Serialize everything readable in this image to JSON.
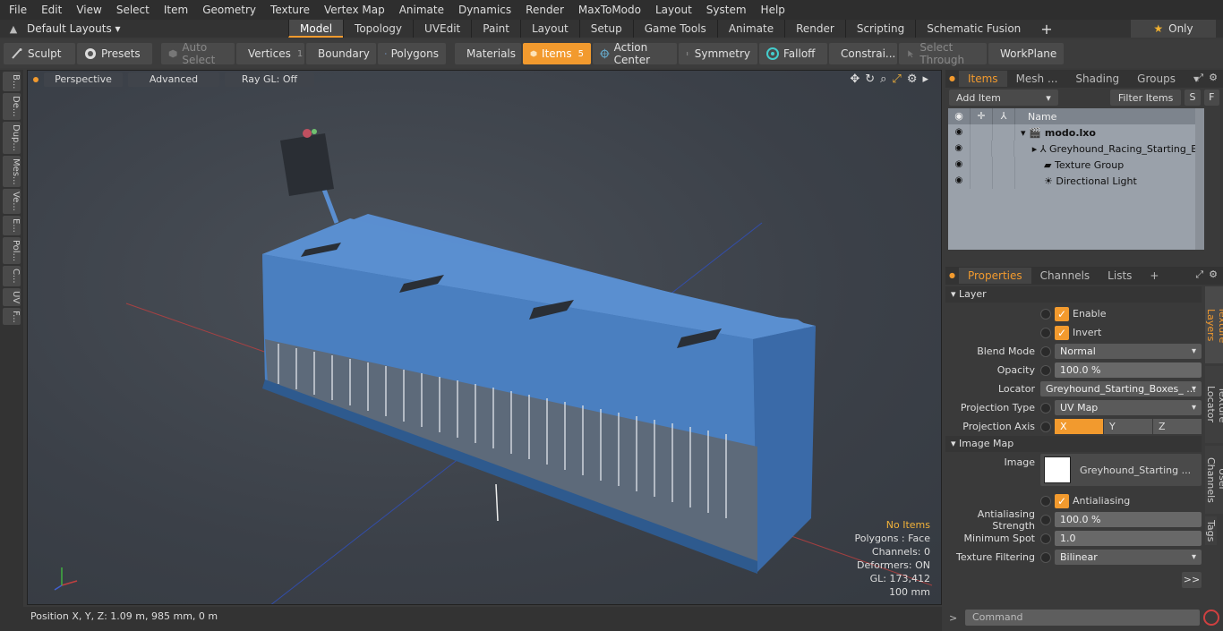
{
  "menu": [
    "File",
    "Edit",
    "View",
    "Select",
    "Item",
    "Geometry",
    "Texture",
    "Vertex Map",
    "Animate",
    "Dynamics",
    "Render",
    "MaxToModo",
    "Layout",
    "System",
    "Help"
  ],
  "layout": {
    "selector": "Default Layouts ▾",
    "tabs": [
      "Model",
      "Topology",
      "UVEdit",
      "Paint",
      "Layout",
      "Setup",
      "Game Tools",
      "Animate",
      "Render",
      "Scripting",
      "Schematic Fusion"
    ],
    "active_tab": "Model",
    "only_label": "Only"
  },
  "toolbar": {
    "sculpt": "Sculpt",
    "presets": "Presets",
    "auto_select": "Auto Select",
    "vertices": "Vertices",
    "vertices_count": "1",
    "boundary": "Boundary",
    "polygons": "Polygons",
    "materials": "Materials",
    "items": "Items",
    "items_count": "5",
    "action_center": "Action Center",
    "symmetry": "Symmetry",
    "falloff": "Falloff",
    "constraints": "Constrai...",
    "select_through": "Select Through",
    "workplane": "WorkPlane"
  },
  "left_tabs": [
    "B...",
    "De...",
    "Dup...",
    "Mes...",
    "Ve...",
    "E...",
    "Pol...",
    "C...",
    "UV",
    "F..."
  ],
  "viewport": {
    "perspective": "Perspective",
    "advanced": "Advanced",
    "raygl": "Ray GL: Off",
    "info": {
      "items": "No Items",
      "polygons": "Polygons : Face",
      "channels": "Channels: 0",
      "deformers": "Deformers: ON",
      "gl": "GL: 173,412",
      "scale": "100 mm"
    }
  },
  "status": {
    "position": "Position X, Y, Z:   1.09 m, 985 mm, 0 m"
  },
  "items_panel": {
    "tabs": [
      "Items",
      "Mesh ...",
      "Shading",
      "Groups"
    ],
    "add_item": "Add Item",
    "filter_items": "Filter Items",
    "s": "S",
    "f": "F",
    "name_col": "Name",
    "rows": [
      {
        "name": "modo.lxo"
      },
      {
        "name": "Greyhound_Racing_Starting_B..."
      },
      {
        "name": "Texture Group"
      },
      {
        "name": "Directional Light"
      }
    ]
  },
  "properties": {
    "tabs": [
      "Properties",
      "Channels",
      "Lists"
    ],
    "layer_section": "Layer",
    "enable": "Enable",
    "invert": "Invert",
    "blend_mode_label": "Blend Mode",
    "blend_mode": "Normal",
    "opacity_label": "Opacity",
    "opacity": "100.0 %",
    "locator_label": "Locator",
    "locator": "Greyhound_Starting_Boxes_ ...",
    "projection_type_label": "Projection Type",
    "projection_type": "UV Map",
    "projection_axis_label": "Projection Axis",
    "axis_x": "X",
    "axis_y": "Y",
    "axis_z": "Z",
    "image_map_section": "Image Map",
    "image_label": "Image",
    "image": "Greyhound_Starting ...",
    "antialiasing": "Antialiasing",
    "aa_strength_label": "Antialiasing Strength",
    "aa_strength": "100.0 %",
    "min_spot_label": "Minimum Spot",
    "min_spot": "1.0",
    "tex_filter_label": "Texture Filtering",
    "tex_filter": "Bilinear",
    "more": ">>"
  },
  "right_vtabs": [
    "Texture Layers",
    "Texture Locator",
    "User Channels",
    "Tags"
  ],
  "command_placeholder": "Command",
  "colors": {
    "accent": "#f29a2e",
    "box_blue": "#4a86c8"
  }
}
